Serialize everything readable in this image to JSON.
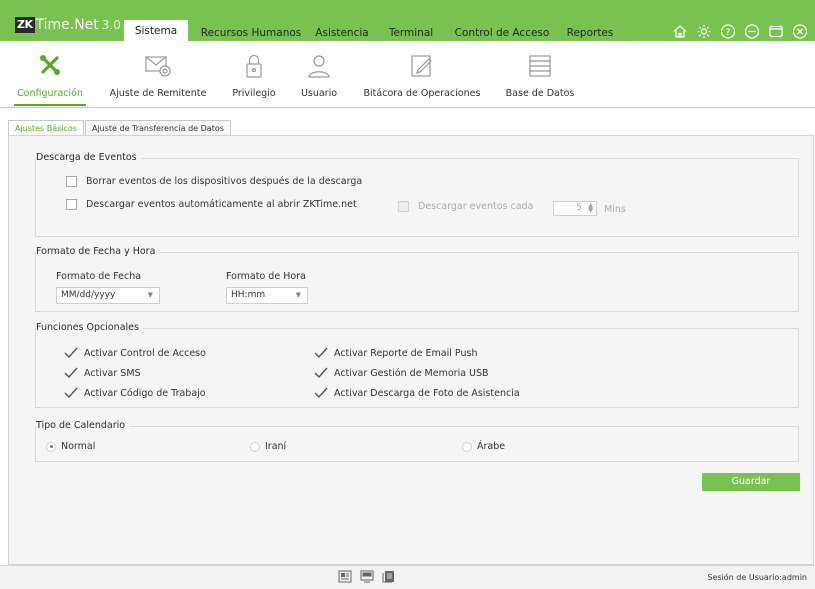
{
  "app": {
    "logo_mark": "ZK",
    "name": "Time.Net",
    "version": "3.0"
  },
  "menu": [
    {
      "label": "Sistema",
      "active": true
    },
    {
      "label": "Recursos Humanos"
    },
    {
      "label": "Asistencia"
    },
    {
      "label": "Terminal"
    },
    {
      "label": "Control de Acceso"
    },
    {
      "label": "Reportes"
    }
  ],
  "window_icons": [
    "home-icon",
    "gear-icon",
    "help-icon",
    "minimize-icon",
    "maximize-icon",
    "close-icon"
  ],
  "toolbar": [
    {
      "label": "Configuración",
      "icon": "tools-icon",
      "active": true
    },
    {
      "label": "Ajuste de Remitente",
      "icon": "mail-settings-icon"
    },
    {
      "label": "Privilegio",
      "icon": "lock-icon"
    },
    {
      "label": "Usuario",
      "icon": "user-icon"
    },
    {
      "label": "Bitácora de Operaciones",
      "icon": "edit-log-icon"
    },
    {
      "label": "Base de Datos",
      "icon": "database-icon"
    }
  ],
  "subtabs": [
    {
      "label": "Ajustes Básicos",
      "active": true
    },
    {
      "label": "Ajuste de Transferencia de Datos"
    }
  ],
  "descarga": {
    "title": "Descarga de Eventos",
    "borrar_label": "Borrar eventos de los dispositivos después de la descarga",
    "auto_label": "Descargar eventos automáticamente al abrir ZKTime.net",
    "cada_label": "Descargar eventos cada",
    "cada_value": "5",
    "cada_unit": "Mins"
  },
  "formato": {
    "title": "Formato de Fecha y Hora",
    "fecha_label": "Formato de Fecha",
    "fecha_value": "MM/dd/yyyy",
    "hora_label": "Formato de Hora",
    "hora_value": "HH:mm"
  },
  "funciones": {
    "title": "Funciones Opcionales",
    "items": [
      "Activar Control de Acceso",
      "Activar SMS",
      "Activar Código de Trabajo",
      "Activar Reporte de Email Push",
      "Activar Gestión de Memoria USB",
      "Activar Descarga de Foto de Asistencia"
    ]
  },
  "calendario": {
    "title": "Tipo de Calendario",
    "options": [
      "Normal",
      "Iraní",
      "Árabe"
    ],
    "selected": "Normal"
  },
  "save_label": "Guardar",
  "status": {
    "session": "Sesión de Usuario:admin"
  },
  "colors": {
    "accent": "#79c150",
    "active_text": "#5aa62d"
  }
}
